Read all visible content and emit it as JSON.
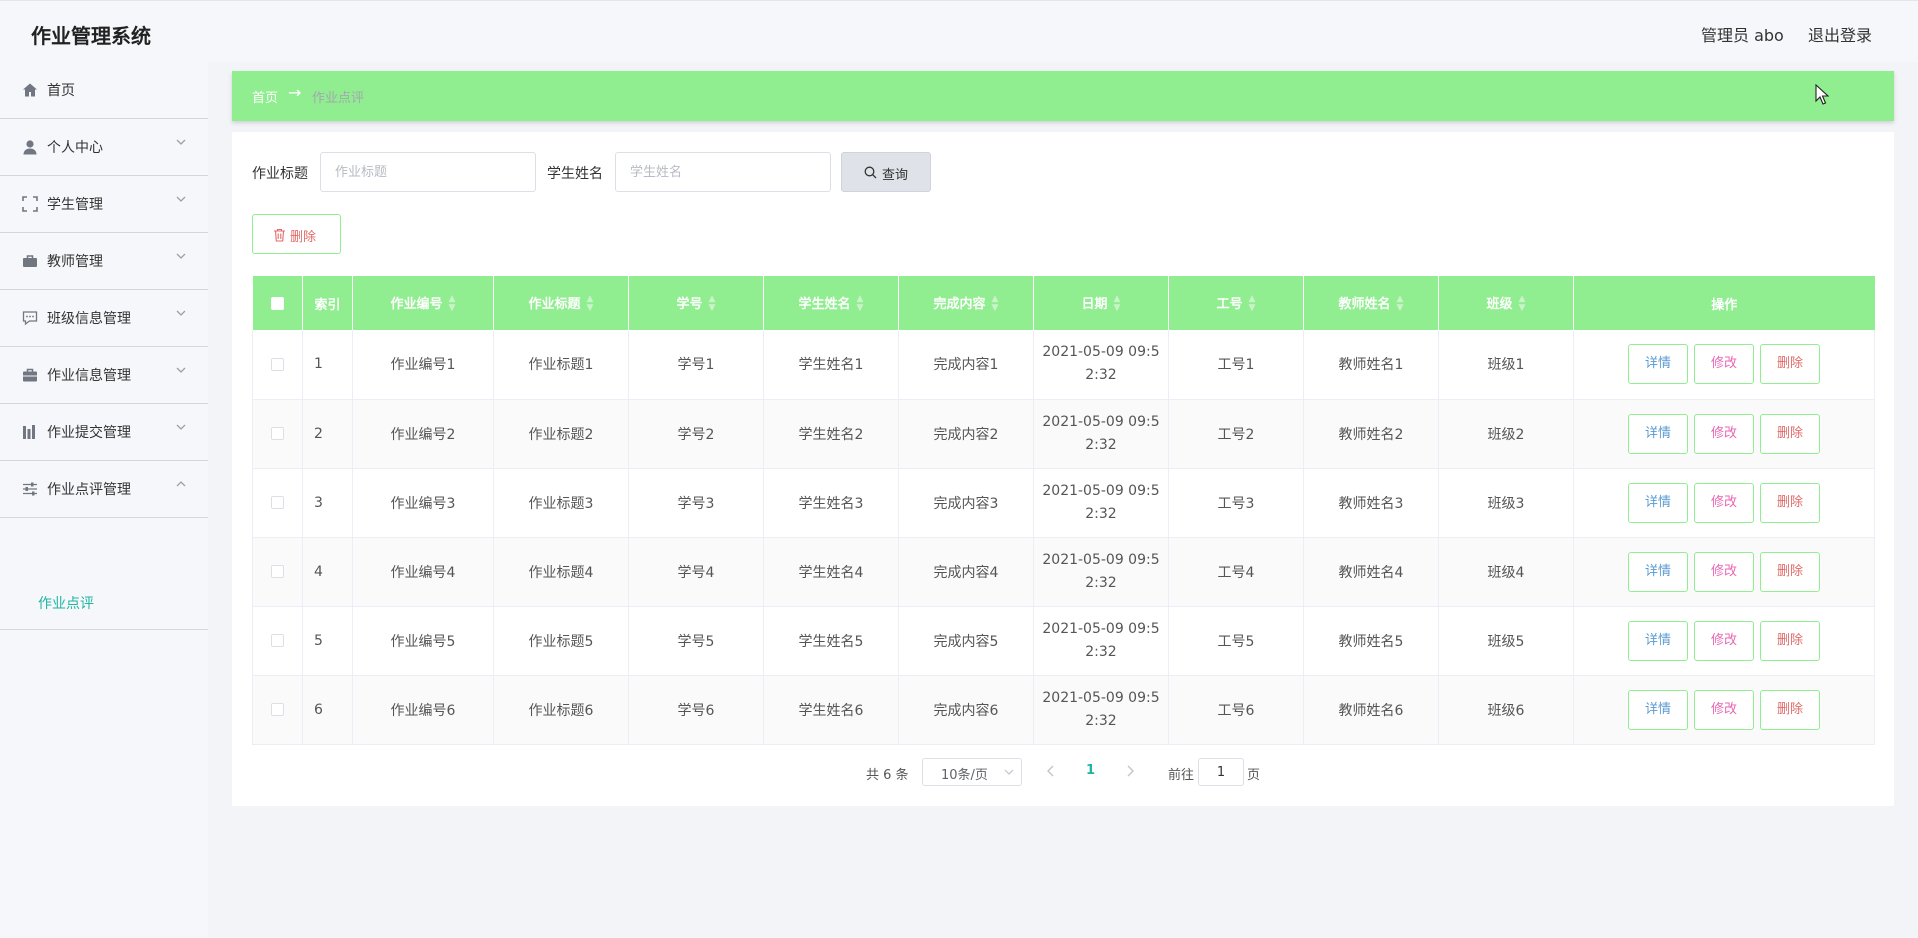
{
  "header": {
    "title": "作业管理系统",
    "admin": "管理员 abo",
    "logout": "退出登录"
  },
  "sidebar": {
    "items": [
      {
        "label": "首页",
        "icon": "home-icon"
      },
      {
        "label": "个人中心",
        "icon": "user-icon"
      },
      {
        "label": "学生管理",
        "icon": "fullscreen-icon"
      },
      {
        "label": "教师管理",
        "icon": "suitcase-icon"
      },
      {
        "label": "班级信息管理",
        "icon": "chat-icon"
      },
      {
        "label": "作业信息管理",
        "icon": "briefcase-icon"
      },
      {
        "label": "作业提交管理",
        "icon": "chart-icon"
      },
      {
        "label": "作业点评管理",
        "icon": "sliders-icon"
      }
    ],
    "sub_item": "作业点评"
  },
  "breadcrumb": {
    "home": "首页",
    "arrow": "→",
    "current": "作业点评"
  },
  "search": {
    "title_label": "作业标题",
    "title_placeholder": "作业标题",
    "name_label": "学生姓名",
    "name_placeholder": "学生姓名",
    "button": "查询"
  },
  "actions": {
    "delete": "删除"
  },
  "table": {
    "headers": [
      "索引",
      "作业编号",
      "作业标题",
      "学号",
      "学生姓名",
      "完成内容",
      "日期",
      "工号",
      "教师姓名",
      "班级",
      "操作"
    ],
    "rows": [
      {
        "index": "1",
        "code": "作业编号1",
        "title": "作业标题1",
        "sid": "学号1",
        "sname": "学生姓名1",
        "content": "完成内容1",
        "date1": "2021-05-09 09:5",
        "date2": "2:32",
        "tid": "工号1",
        "tname": "教师姓名1",
        "cls": "班级1"
      },
      {
        "index": "2",
        "code": "作业编号2",
        "title": "作业标题2",
        "sid": "学号2",
        "sname": "学生姓名2",
        "content": "完成内容2",
        "date1": "2021-05-09 09:5",
        "date2": "2:32",
        "tid": "工号2",
        "tname": "教师姓名2",
        "cls": "班级2"
      },
      {
        "index": "3",
        "code": "作业编号3",
        "title": "作业标题3",
        "sid": "学号3",
        "sname": "学生姓名3",
        "content": "完成内容3",
        "date1": "2021-05-09 09:5",
        "date2": "2:32",
        "tid": "工号3",
        "tname": "教师姓名3",
        "cls": "班级3"
      },
      {
        "index": "4",
        "code": "作业编号4",
        "title": "作业标题4",
        "sid": "学号4",
        "sname": "学生姓名4",
        "content": "完成内容4",
        "date1": "2021-05-09 09:5",
        "date2": "2:32",
        "tid": "工号4",
        "tname": "教师姓名4",
        "cls": "班级4"
      },
      {
        "index": "5",
        "code": "作业编号5",
        "title": "作业标题5",
        "sid": "学号5",
        "sname": "学生姓名5",
        "content": "完成内容5",
        "date1": "2021-05-09 09:5",
        "date2": "2:32",
        "tid": "工号5",
        "tname": "教师姓名5",
        "cls": "班级5"
      },
      {
        "index": "6",
        "code": "作业编号6",
        "title": "作业标题6",
        "sid": "学号6",
        "sname": "学生姓名6",
        "content": "完成内容6",
        "date1": "2021-05-09 09:5",
        "date2": "2:32",
        "tid": "工号6",
        "tname": "教师姓名6",
        "cls": "班级6"
      }
    ],
    "ops": {
      "detail": "详情",
      "edit": "修改",
      "delete": "删除"
    }
  },
  "pagination": {
    "total": "共 6 条",
    "page_size": "10条/页",
    "current": "1",
    "goto": "前往",
    "goto_value": "1",
    "suffix": "页"
  },
  "colors": {
    "accent_green": "#90ee90",
    "active_teal": "#1fb5a3",
    "danger": "#e16a6a",
    "edit_pink": "#e867b3",
    "detail_blue": "#5b9bd1"
  }
}
